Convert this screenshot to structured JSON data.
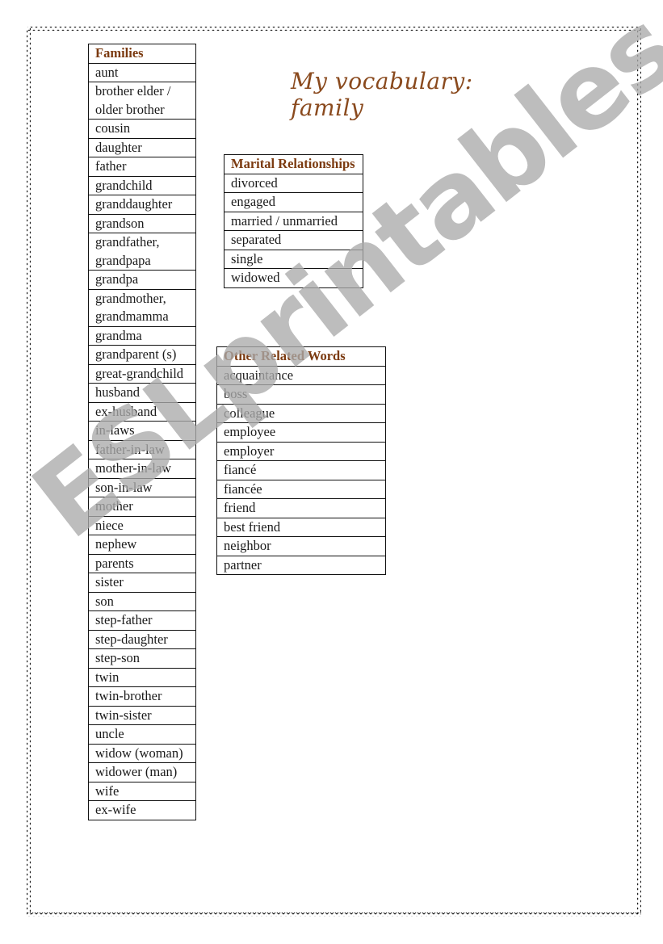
{
  "title": "My vocabulary: family",
  "watermark": "ESLprintables.com",
  "families": {
    "header": "Families",
    "items": [
      "aunt",
      "brother elder / older brother",
      "cousin",
      "daughter",
      "father",
      "grandchild",
      "granddaughter",
      "grandson",
      "grandfather, grandpapa",
      "grandpa",
      "grandmother, grandmamma",
      "grandma",
      "grandparent (s)",
      "great-grandchild",
      "husband",
      "ex-husband",
      "in-laws",
      "father-in-law",
      "mother-in-law",
      "son-in-law",
      "mother",
      "niece",
      "nephew",
      "parents",
      "sister",
      "son",
      "step-father",
      "step-daughter",
      "step-son",
      "twin",
      "twin-brother",
      "twin-sister",
      "uncle",
      "widow (woman)",
      "widower (man)",
      "wife",
      "ex-wife"
    ]
  },
  "marital": {
    "header": "Marital Relationships",
    "items": [
      "divorced",
      "engaged",
      "married / unmarried",
      "separated",
      "single",
      "widowed"
    ]
  },
  "other": {
    "header": "Other Related Words",
    "items": [
      "acquaintance",
      "boss",
      "colleague",
      "employee",
      "employer",
      "fiancé",
      "fiancée",
      "friend",
      "best friend",
      "neighbor",
      "partner"
    ]
  },
  "colors": {
    "heading": "#7b3a10",
    "title": "#8a4a1e",
    "watermark": "#aaaaaa"
  }
}
